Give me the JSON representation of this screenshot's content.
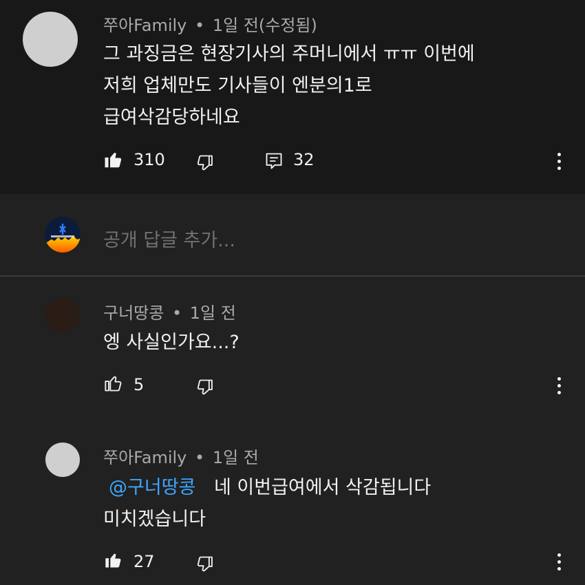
{
  "top_comment": {
    "author": "쭈아Family",
    "time": "1일 전(수정됨)",
    "lines": [
      "그 과징금은 현장기사의 주머니에서 ㅠㅠ 이번에",
      "저희 업체만도 기사들이 엔분의1로",
      "급여삭감당하네요"
    ],
    "likes": "310",
    "replies": "32"
  },
  "reply_box": {
    "placeholder": "공개 답글 추가..."
  },
  "replies": [
    {
      "author": "구너땅콩",
      "time": "1일 전",
      "text": "엥 사실인가요...?",
      "likes": "5"
    },
    {
      "author": "쭈아Family",
      "time": "1일 전",
      "mention": "@구너땅콩",
      "line1": "네 이번급여에서 삭감됩니다",
      "line2": "미치겠습니다",
      "likes": "27"
    }
  ],
  "separator": "•",
  "colors": {
    "background": "#181818",
    "panel": "#212121",
    "mention": "#3ea6ff",
    "meta": "#aaaaaa"
  }
}
